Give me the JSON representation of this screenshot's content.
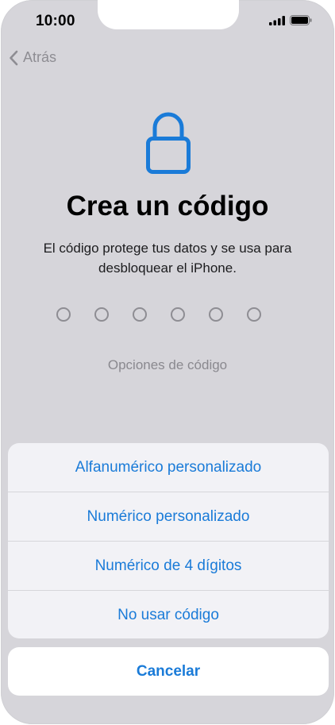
{
  "status_bar": {
    "time": "10:00"
  },
  "nav": {
    "back_label": "Atrás"
  },
  "header": {
    "title": "Crea un código",
    "subtitle": "El código protege tus datos y se usa para desbloquear el iPhone."
  },
  "passcode": {
    "digits": 6
  },
  "options_label": "Opciones de código",
  "action_sheet": {
    "items": [
      {
        "label": "Alfanumérico personalizado"
      },
      {
        "label": "Numérico personalizado"
      },
      {
        "label": "Numérico de 4 dígitos"
      },
      {
        "label": "No usar código"
      }
    ],
    "cancel_label": "Cancelar"
  },
  "colors": {
    "accent": "#1a7bd8",
    "background": "#d6d5da",
    "sheet": "#f2f2f6"
  },
  "icons": [
    "signal-icon",
    "battery-icon",
    "chevron-left-icon",
    "lock-icon"
  ]
}
